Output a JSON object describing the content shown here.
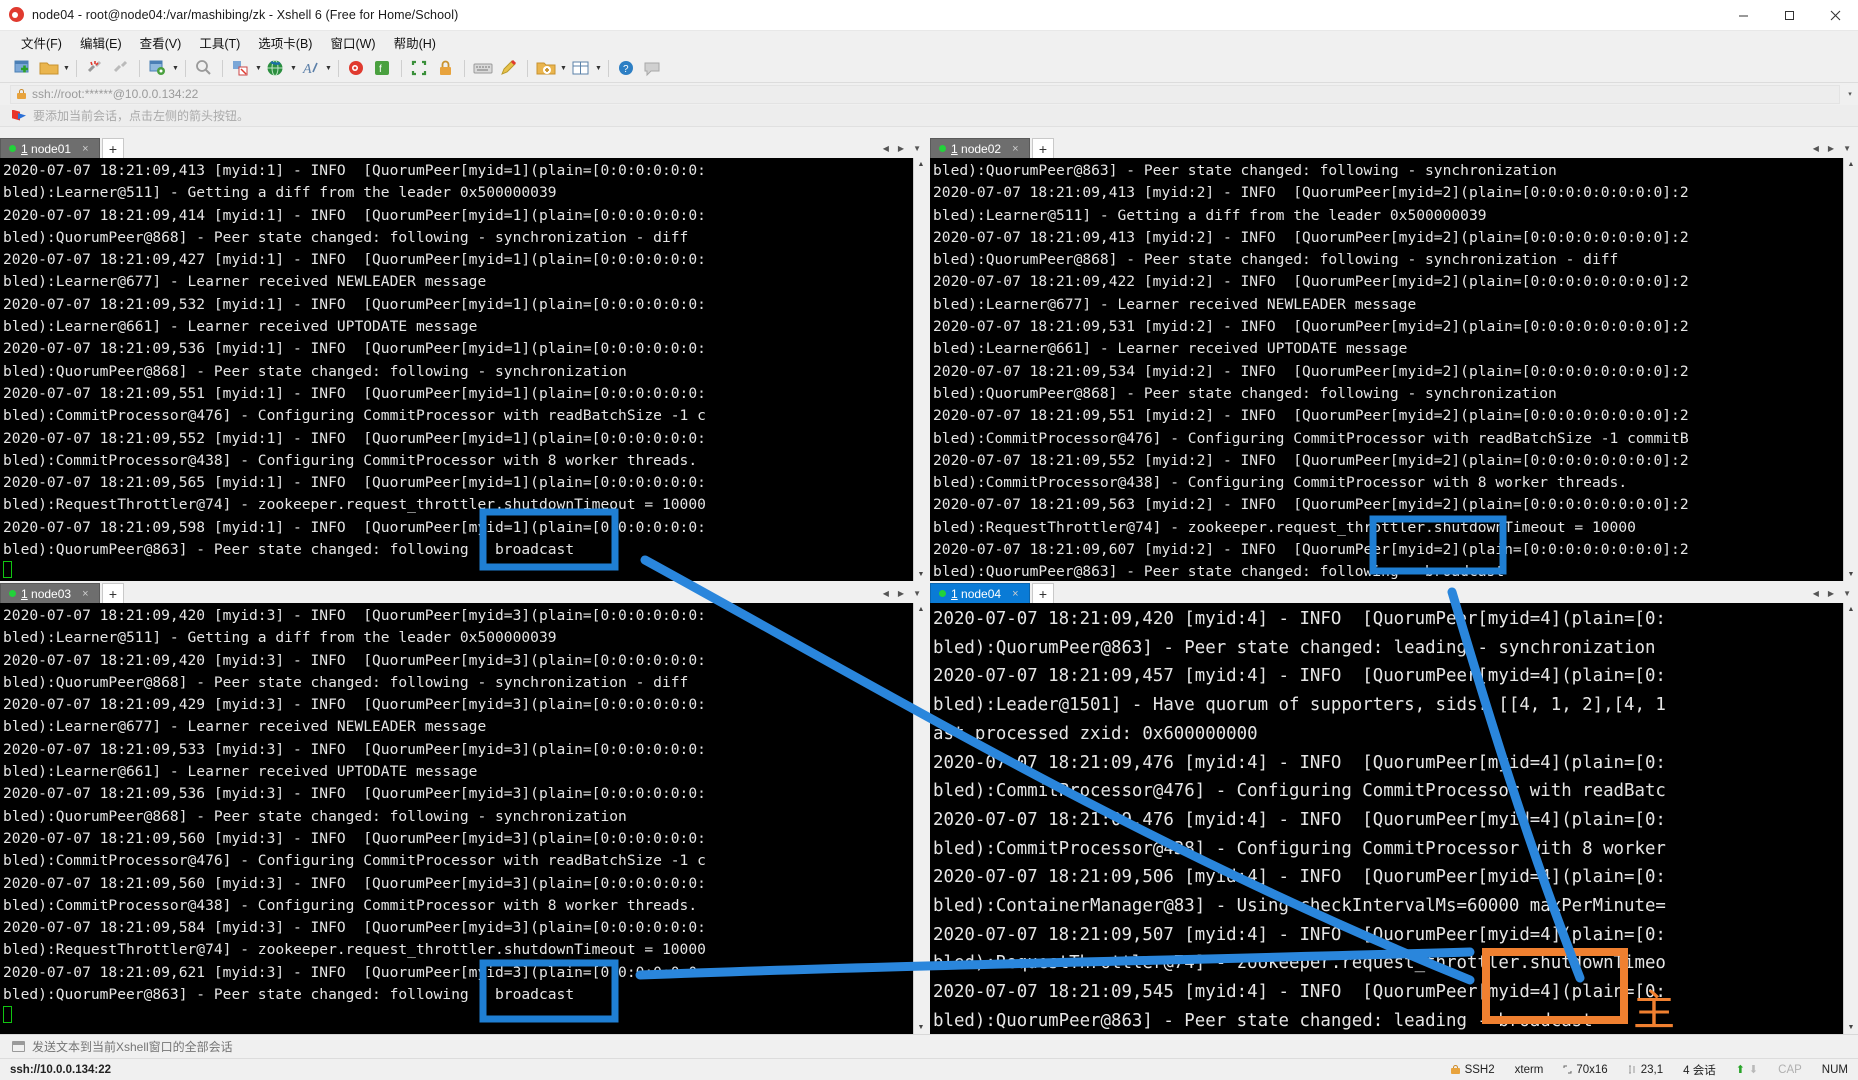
{
  "window": {
    "title": "node04 - root@node04:/var/mashibing/zk - Xshell 6 (Free for Home/School)",
    "app_icon": "xshell-logo-icon",
    "minimize": "–",
    "maximize": "□",
    "close": "✕"
  },
  "menubar": [
    {
      "label": "文件(F)"
    },
    {
      "label": "编辑(E)"
    },
    {
      "label": "查看(V)"
    },
    {
      "label": "工具(T)"
    },
    {
      "label": "选项卡(B)"
    },
    {
      "label": "窗口(W)"
    },
    {
      "label": "帮助(H)"
    }
  ],
  "toolbar": {
    "icons": [
      "new-session-icon",
      "open-folder-icon",
      "dropdown-arrow",
      "separator",
      "disconnect-icon",
      "reconnect-icon",
      "separator",
      "session-properties-icon",
      "dropdown-arrow",
      "separator",
      "find-icon",
      "separator",
      "file-transfer-icon",
      "dropdown-arrow",
      "globe-icon",
      "dropdown-arrow",
      "font-icon",
      "dropdown-arrow",
      "separator",
      "xshell-icon",
      "xftp-icon",
      "separator",
      "fullscreen-icon",
      "lock-icon",
      "separator",
      "keyboard-icon",
      "highlight-pen-icon",
      "separator",
      "add-folder-icon",
      "dropdown-arrow",
      "layout-icon",
      "dropdown-arrow",
      "separator",
      "help-icon",
      "comment-icon"
    ]
  },
  "address_bar": {
    "icon": "lock-icon",
    "value": "ssh://root:******@10.0.0.134:22",
    "caret": "▾"
  },
  "hint_bar": {
    "icon": "red-blue-flag-icon",
    "text": "要添加当前会话，点击左侧的箭头按钮。"
  },
  "panes": [
    {
      "id": "node01",
      "tab": {
        "index": "1",
        "name": "node01",
        "close": "×",
        "dot_color": "#22d23a",
        "active": false
      },
      "new_tab_label": "+",
      "lines": [
        "2020-07-07 18:21:09,413 [myid:1] - INFO  [QuorumPeer[myid=1](plain=[0:0:0:0:0:0:",
        "bled):Learner@511] - Getting a diff from the leader 0x500000039",
        "2020-07-07 18:21:09,414 [myid:1] - INFO  [QuorumPeer[myid=1](plain=[0:0:0:0:0:0:",
        "bled):QuorumPeer@868] - Peer state changed: following - synchronization - diff",
        "2020-07-07 18:21:09,427 [myid:1] - INFO  [QuorumPeer[myid=1](plain=[0:0:0:0:0:0:",
        "bled):Learner@677] - Learner received NEWLEADER message",
        "2020-07-07 18:21:09,532 [myid:1] - INFO  [QuorumPeer[myid=1](plain=[0:0:0:0:0:0:",
        "bled):Learner@661] - Learner received UPTODATE message",
        "2020-07-07 18:21:09,536 [myid:1] - INFO  [QuorumPeer[myid=1](plain=[0:0:0:0:0:0:",
        "bled):QuorumPeer@868] - Peer state changed: following - synchronization",
        "2020-07-07 18:21:09,551 [myid:1] - INFO  [QuorumPeer[myid=1](plain=[0:0:0:0:0:0:",
        "bled):CommitProcessor@476] - Configuring CommitProcessor with readBatchSize -1 c",
        "2020-07-07 18:21:09,552 [myid:1] - INFO  [QuorumPeer[myid=1](plain=[0:0:0:0:0:0:",
        "bled):CommitProcessor@438] - Configuring CommitProcessor with 8 worker threads.",
        "2020-07-07 18:21:09,565 [myid:1] - INFO  [QuorumPeer[myid=1](plain=[0:0:0:0:0:0:",
        "bled):RequestThrottler@74] - zookeeper.request_throttler.shutdownTimeout = 10000",
        "2020-07-07 18:21:09,598 [myid:1] - INFO  [QuorumPeer[myid=1](plain=[0:0:0:0:0:0:",
        "bled):QuorumPeer@863] - Peer state changed: following - broadcast"
      ],
      "prompt_cursor": "hollow"
    },
    {
      "id": "node02",
      "tab": {
        "index": "1",
        "name": "node02",
        "close": "×",
        "dot_color": "#22d23a",
        "active": false
      },
      "new_tab_label": "+",
      "lines": [
        "bled):QuorumPeer@863] - Peer state changed: following - synchronization",
        "2020-07-07 18:21:09,413 [myid:2] - INFO  [QuorumPeer[myid=2](plain=[0:0:0:0:0:0:0:0]:2",
        "bled):Learner@511] - Getting a diff from the leader 0x500000039",
        "2020-07-07 18:21:09,413 [myid:2] - INFO  [QuorumPeer[myid=2](plain=[0:0:0:0:0:0:0:0]:2",
        "bled):QuorumPeer@868] - Peer state changed: following - synchronization - diff",
        "2020-07-07 18:21:09,422 [myid:2] - INFO  [QuorumPeer[myid=2](plain=[0:0:0:0:0:0:0:0]:2",
        "bled):Learner@677] - Learner received NEWLEADER message",
        "2020-07-07 18:21:09,531 [myid:2] - INFO  [QuorumPeer[myid=2](plain=[0:0:0:0:0:0:0:0]:2",
        "bled):Learner@661] - Learner received UPTODATE message",
        "2020-07-07 18:21:09,534 [myid:2] - INFO  [QuorumPeer[myid=2](plain=[0:0:0:0:0:0:0:0]:2",
        "bled):QuorumPeer@868] - Peer state changed: following - synchronization",
        "2020-07-07 18:21:09,551 [myid:2] - INFO  [QuorumPeer[myid=2](plain=[0:0:0:0:0:0:0:0]:2",
        "bled):CommitProcessor@476] - Configuring CommitProcessor with readBatchSize -1 commitB",
        "2020-07-07 18:21:09,552 [myid:2] - INFO  [QuorumPeer[myid=2](plain=[0:0:0:0:0:0:0:0]:2",
        "bled):CommitProcessor@438] - Configuring CommitProcessor with 8 worker threads.",
        "2020-07-07 18:21:09,563 [myid:2] - INFO  [QuorumPeer[myid=2](plain=[0:0:0:0:0:0:0:0]:2",
        "bled):RequestThrottler@74] - zookeeper.request_throttler.shutdownTimeout = 10000",
        "2020-07-07 18:21:09,607 [myid:2] - INFO  [QuorumPeer[myid=2](plain=[0:0:0:0:0:0:0:0]:2",
        "bled):QuorumPeer@863] - Peer state changed: following - broadcast"
      ],
      "prompt_cursor": "hollow"
    },
    {
      "id": "node03",
      "tab": {
        "index": "1",
        "name": "node03",
        "close": "×",
        "dot_color": "#22d23a",
        "active": false
      },
      "new_tab_label": "+",
      "lines": [
        "2020-07-07 18:21:09,420 [myid:3] - INFO  [QuorumPeer[myid=3](plain=[0:0:0:0:0:0:",
        "bled):Learner@511] - Getting a diff from the leader 0x500000039",
        "2020-07-07 18:21:09,420 [myid:3] - INFO  [QuorumPeer[myid=3](plain=[0:0:0:0:0:0:",
        "bled):QuorumPeer@868] - Peer state changed: following - synchronization - diff",
        "2020-07-07 18:21:09,429 [myid:3] - INFO  [QuorumPeer[myid=3](plain=[0:0:0:0:0:0:",
        "bled):Learner@677] - Learner received NEWLEADER message",
        "2020-07-07 18:21:09,533 [myid:3] - INFO  [QuorumPeer[myid=3](plain=[0:0:0:0:0:0:",
        "bled):Learner@661] - Learner received UPTODATE message",
        "2020-07-07 18:21:09,536 [myid:3] - INFO  [QuorumPeer[myid=3](plain=[0:0:0:0:0:0:",
        "bled):QuorumPeer@868] - Peer state changed: following - synchronization",
        "2020-07-07 18:21:09,560 [myid:3] - INFO  [QuorumPeer[myid=3](plain=[0:0:0:0:0:0:",
        "bled):CommitProcessor@476] - Configuring CommitProcessor with readBatchSize -1 c",
        "2020-07-07 18:21:09,560 [myid:3] - INFO  [QuorumPeer[myid=3](plain=[0:0:0:0:0:0:",
        "bled):CommitProcessor@438] - Configuring CommitProcessor with 8 worker threads.",
        "2020-07-07 18:21:09,584 [myid:3] - INFO  [QuorumPeer[myid=3](plain=[0:0:0:0:0:0:",
        "bled):RequestThrottler@74] - zookeeper.request_throttler.shutdownTimeout = 10000",
        "2020-07-07 18:21:09,621 [myid:3] - INFO  [QuorumPeer[myid=3](plain=[0:0:0:0:0:0:",
        "bled):QuorumPeer@863] - Peer state changed: following - broadcast"
      ],
      "prompt_cursor": "hollow"
    },
    {
      "id": "node04",
      "tab": {
        "index": "1",
        "name": "node04",
        "close": "×",
        "dot_color": "#22d23a",
        "active": true
      },
      "new_tab_label": "+",
      "lines": [
        "2020-07-07 18:21:09,420 [myid:4] - INFO  [QuorumPeer[myid=4](plain=[0:",
        "bled):QuorumPeer@863] - Peer state changed: leading - synchronization",
        "2020-07-07 18:21:09,457 [myid:4] - INFO  [QuorumPeer[myid=4](plain=[0:",
        "bled):Leader@1501] - Have quorum of supporters, sids: [[4, 1, 2],[4, 1",
        "ast processed zxid: 0x600000000",
        "2020-07-07 18:21:09,476 [myid:4] - INFO  [QuorumPeer[myid=4](plain=[0:",
        "bled):CommitProcessor@476] - Configuring CommitProcessor with readBatc",
        "2020-07-07 18:21:09,476 [myid:4] - INFO  [QuorumPeer[myid=4](plain=[0:",
        "bled):CommitProcessor@438] - Configuring CommitProcessor with 8 worker",
        "2020-07-07 18:21:09,506 [myid:4] - INFO  [QuorumPeer[myid=4](plain=[0:",
        "bled):ContainerManager@83] - Using checkIntervalMs=60000 maxPerMinute=",
        "2020-07-07 18:21:09,507 [myid:4] - INFO  [QuorumPeer[myid=4](plain=[0:",
        "bled):RequestThrottler@74] - zookeeper.request_throttler.shutdownTimeo",
        "2020-07-07 18:21:09,545 [myid:4] - INFO  [QuorumPeer[myid=4](plain=[0:",
        "bled):QuorumPeer@863] - Peer state changed: leading - broadcast"
      ],
      "prompt_cursor": "block"
    }
  ],
  "annotations": {
    "highlight_color_follower": "#1f7fd4",
    "highlight_color_leader": "#f08030",
    "boxes": [
      {
        "name": "node01-following-box",
        "label": "following",
        "color": "#1f7fd4"
      },
      {
        "name": "node02-following-box",
        "label": "following",
        "color": "#1f7fd4"
      },
      {
        "name": "node03-following-box",
        "label": "following",
        "color": "#1f7fd4"
      },
      {
        "name": "node04-leading-box",
        "label": "leading",
        "color": "#f08030"
      }
    ],
    "leader_marker": {
      "text": "主",
      "color": "#f08030"
    }
  },
  "composer": {
    "icon": "send-to-all-sessions-icon",
    "placeholder": "发送文本到当前Xshell窗口的全部会话"
  },
  "statusbar": {
    "left": "ssh://10.0.0.134:22",
    "protocol": "SSH2",
    "terminal": "xterm",
    "size_icon": "terminal-size-icon",
    "size": "70x16",
    "cursor_icon": "cursor-pos-icon",
    "cursor": "23,1",
    "sessions": "4 会话",
    "up_arrow": "⬆",
    "down_arrow": "⬇",
    "caps": "CAP",
    "num": "NUM"
  }
}
